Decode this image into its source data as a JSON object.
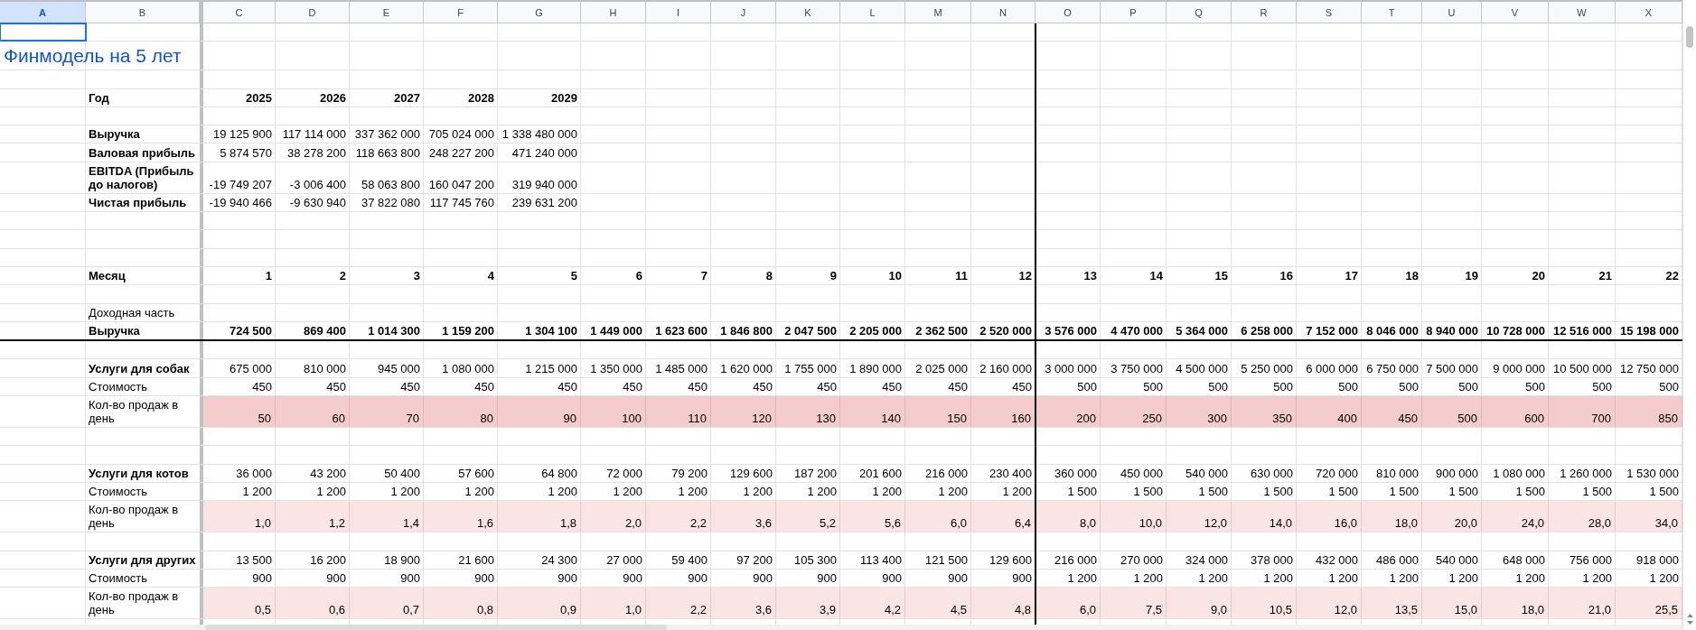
{
  "columns": [
    {
      "label": "A",
      "selected": true
    },
    {
      "label": "B",
      "selected": false
    },
    {
      "label": "C",
      "selected": false
    },
    {
      "label": "D",
      "selected": false
    },
    {
      "label": "E",
      "selected": false
    },
    {
      "label": "F",
      "selected": false
    },
    {
      "label": "G",
      "selected": false
    },
    {
      "label": "H",
      "selected": false
    },
    {
      "label": "I",
      "selected": false
    },
    {
      "label": "J",
      "selected": false
    },
    {
      "label": "K",
      "selected": false
    },
    {
      "label": "L",
      "selected": false
    },
    {
      "label": "M",
      "selected": false
    },
    {
      "label": "N",
      "selected": false
    },
    {
      "label": "O",
      "selected": false,
      "border_left": true
    },
    {
      "label": "P",
      "selected": false
    },
    {
      "label": "Q",
      "selected": false
    },
    {
      "label": "R",
      "selected": false
    },
    {
      "label": "S",
      "selected": false
    },
    {
      "label": "T",
      "selected": false
    },
    {
      "label": "U",
      "selected": false
    },
    {
      "label": "V",
      "selected": false
    },
    {
      "label": "W",
      "selected": false
    },
    {
      "label": "X",
      "selected": false
    }
  ],
  "rows": [
    {
      "kind": "blank"
    },
    {
      "kind": "title",
      "text": "Финмодель на 5 лет"
    },
    {
      "kind": "blank"
    },
    {
      "kind": "data",
      "label": "Год",
      "label_bold": true,
      "values_bold": true,
      "cells": [
        "2025",
        "2026",
        "2027",
        "2028",
        "2029"
      ]
    },
    {
      "kind": "blank"
    },
    {
      "kind": "data",
      "label": "Выручка",
      "label_bold": true,
      "values_bold": false,
      "cells": [
        "19 125 900",
        "117 114 000",
        "337 362 000",
        "705 024 000",
        "1 338 480 000"
      ]
    },
    {
      "kind": "data",
      "label": "Валовая прибыль",
      "label_bold": true,
      "values_bold": false,
      "cells": [
        "5 874 570",
        "38 278 200",
        "118 663 800",
        "248 227 200",
        "471 240 000"
      ]
    },
    {
      "kind": "data",
      "label": "EBITDA (Прибыль до налогов)",
      "label_bold": true,
      "values_bold": false,
      "cells": [
        "-19 749 207",
        "-3 006 400",
        "58 063 800",
        "160 047 200",
        "319 940 000"
      ]
    },
    {
      "kind": "data",
      "label": "Чистая прибыль",
      "label_bold": true,
      "values_bold": false,
      "cells": [
        "-19 940 466",
        "-9 630 940",
        "37 822 080",
        "117 745 760",
        "239 631 200"
      ]
    },
    {
      "kind": "blank"
    },
    {
      "kind": "blank"
    },
    {
      "kind": "blank"
    },
    {
      "kind": "data",
      "label": "Месяц",
      "label_bold": true,
      "values_bold": true,
      "cells": [
        "1",
        "2",
        "3",
        "4",
        "5",
        "6",
        "7",
        "8",
        "9",
        "10",
        "11",
        "12",
        "13",
        "14",
        "15",
        "16",
        "17",
        "18",
        "19",
        "20",
        "21",
        "22"
      ]
    },
    {
      "kind": "blank"
    },
    {
      "kind": "data",
      "label": "Доходная часть",
      "label_bold": false
    },
    {
      "kind": "data",
      "label": "Выручка",
      "label_bold": true,
      "values_bold": true,
      "rule_below": true,
      "cells": [
        "724 500",
        "869 400",
        "1 014 300",
        "1 159 200",
        "1 304 100",
        "1 449 000",
        "1 623 600",
        "1 846 800",
        "2 047 500",
        "2 205 000",
        "2 362 500",
        "2 520 000",
        "3 576 000",
        "4 470 000",
        "5 364 000",
        "6 258 000",
        "7 152 000",
        "8 046 000",
        "8 940 000",
        "10 728 000",
        "12 516 000",
        "15 198 000"
      ]
    },
    {
      "kind": "blank"
    },
    {
      "kind": "data",
      "label": "Услуги для собак",
      "label_bold": true,
      "values_bold": false,
      "cells": [
        "675 000",
        "810 000",
        "945 000",
        "1 080 000",
        "1 215 000",
        "1 350 000",
        "1 485 000",
        "1 620 000",
        "1 755 000",
        "1 890 000",
        "2 025 000",
        "2 160 000",
        "3 000 000",
        "3 750 000",
        "4 500 000",
        "5 250 000",
        "6 000 000",
        "6 750 000",
        "7 500 000",
        "9 000 000",
        "10 500 000",
        "12 750 000"
      ]
    },
    {
      "kind": "data",
      "label": "Стоимость",
      "label_bold": false,
      "values_bold": false,
      "cells": [
        "450",
        "450",
        "450",
        "450",
        "450",
        "450",
        "450",
        "450",
        "450",
        "450",
        "450",
        "450",
        "500",
        "500",
        "500",
        "500",
        "500",
        "500",
        "500",
        "500",
        "500",
        "500"
      ]
    },
    {
      "kind": "data",
      "label": "Кол-во продаж в день",
      "label_bold": false,
      "values_bold": false,
      "color": "#f4cccc",
      "cells": [
        "50",
        "60",
        "70",
        "80",
        "90",
        "100",
        "110",
        "120",
        "130",
        "140",
        "150",
        "160",
        "200",
        "250",
        "300",
        "350",
        "400",
        "450",
        "500",
        "600",
        "700",
        "850"
      ]
    },
    {
      "kind": "blank"
    },
    {
      "kind": "blank"
    },
    {
      "kind": "data",
      "label": "Услуги для котов",
      "label_bold": true,
      "values_bold": false,
      "cells": [
        "36 000",
        "43 200",
        "50 400",
        "57 600",
        "64 800",
        "72 000",
        "79 200",
        "129 600",
        "187 200",
        "201 600",
        "216 000",
        "230 400",
        "360 000",
        "450 000",
        "540 000",
        "630 000",
        "720 000",
        "810 000",
        "900 000",
        "1 080 000",
        "1 260 000",
        "1 530 000"
      ]
    },
    {
      "kind": "data",
      "label": "Стоимость",
      "label_bold": false,
      "values_bold": false,
      "cells": [
        "1 200",
        "1 200",
        "1 200",
        "1 200",
        "1 200",
        "1 200",
        "1 200",
        "1 200",
        "1 200",
        "1 200",
        "1 200",
        "1 200",
        "1 500",
        "1 500",
        "1 500",
        "1 500",
        "1 500",
        "1 500",
        "1 500",
        "1 500",
        "1 500",
        "1 500"
      ]
    },
    {
      "kind": "data",
      "label": "Кол-во продаж в день",
      "label_bold": false,
      "values_bold": false,
      "color": "#fbe4e4",
      "cells": [
        "1,0",
        "1,2",
        "1,4",
        "1,6",
        "1,8",
        "2,0",
        "2,2",
        "3,6",
        "5,2",
        "5,6",
        "6,0",
        "6,4",
        "8,0",
        "10,0",
        "12,0",
        "14,0",
        "16,0",
        "18,0",
        "20,0",
        "24,0",
        "28,0",
        "34,0"
      ]
    },
    {
      "kind": "blank"
    },
    {
      "kind": "data",
      "label": "Услуги для других",
      "label_bold": true,
      "values_bold": false,
      "cells": [
        "13 500",
        "16 200",
        "18 900",
        "21 600",
        "24 300",
        "27 000",
        "59 400",
        "97 200",
        "105 300",
        "113 400",
        "121 500",
        "129 600",
        "216 000",
        "270 000",
        "324 000",
        "378 000",
        "432 000",
        "486 000",
        "540 000",
        "648 000",
        "756 000",
        "918 000"
      ]
    },
    {
      "kind": "data",
      "label": "Стоимость",
      "label_bold": false,
      "values_bold": false,
      "cells": [
        "900",
        "900",
        "900",
        "900",
        "900",
        "900",
        "900",
        "900",
        "900",
        "900",
        "900",
        "900",
        "1 200",
        "1 200",
        "1 200",
        "1 200",
        "1 200",
        "1 200",
        "1 200",
        "1 200",
        "1 200",
        "1 200"
      ]
    },
    {
      "kind": "data",
      "label": "Кол-во продаж в день",
      "label_bold": false,
      "values_bold": false,
      "color": "#fbe4e4",
      "cells": [
        "0,5",
        "0,6",
        "0,7",
        "0,8",
        "0,9",
        "1,0",
        "2,2",
        "3,6",
        "3,9",
        "4,2",
        "4,5",
        "4,8",
        "6,0",
        "7,5",
        "9,0",
        "10,5",
        "12,0",
        "13,5",
        "15,0",
        "18,0",
        "21,0",
        "25,5"
      ]
    },
    {
      "kind": "blank"
    }
  ]
}
